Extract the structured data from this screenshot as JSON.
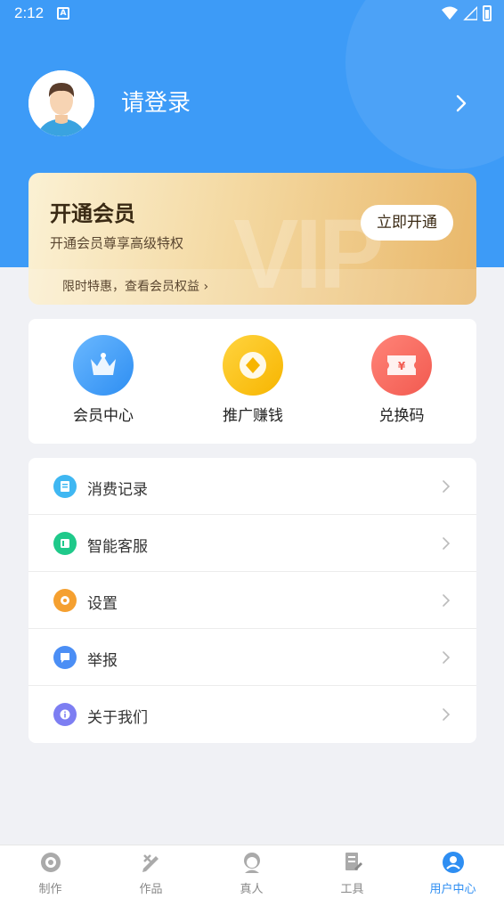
{
  "status_bar": {
    "time": "2:12",
    "notification_icon": "A"
  },
  "header": {
    "login_text": "请登录",
    "avatar_icon": "avatar-placeholder-icon",
    "chevron_icon": "chevron-right-icon"
  },
  "vip_card": {
    "title": "开通会员",
    "subtitle": "开通会员尊享高级特权",
    "button_label": "立即开通",
    "link_text": "限时特惠，查看会员权益 ›",
    "watermark": "VIP"
  },
  "quick_actions": [
    {
      "label": "会员中心",
      "icon": "crown-icon",
      "color": "#2e8ef2"
    },
    {
      "label": "推广赚钱",
      "icon": "coin-icon",
      "color": "#f7b500"
    },
    {
      "label": "兑换码",
      "icon": "ticket-icon",
      "color": "#f25a50"
    }
  ],
  "menu": [
    {
      "label": "消费记录",
      "icon": "receipt-icon",
      "color": "#3fb7f2"
    },
    {
      "label": "智能客服",
      "icon": "service-icon",
      "color": "#1fc98a"
    },
    {
      "label": "设置",
      "icon": "gear-icon",
      "color": "#f5a030"
    },
    {
      "label": "举报",
      "icon": "report-icon",
      "color": "#4b8ef5"
    },
    {
      "label": "关于我们",
      "icon": "info-icon",
      "color": "#7d7ef2"
    }
  ],
  "tabs": [
    {
      "label": "制作",
      "icon": "create-icon",
      "active": false
    },
    {
      "label": "作品",
      "icon": "works-icon",
      "active": false
    },
    {
      "label": "真人",
      "icon": "person-icon",
      "active": false
    },
    {
      "label": "工具",
      "icon": "tools-icon",
      "active": false
    },
    {
      "label": "用户中心",
      "icon": "user-center-icon",
      "active": true
    }
  ],
  "colors": {
    "primary": "#3d9bf7",
    "active_tab": "#2e8ef2",
    "background": "#f0f1f5"
  }
}
